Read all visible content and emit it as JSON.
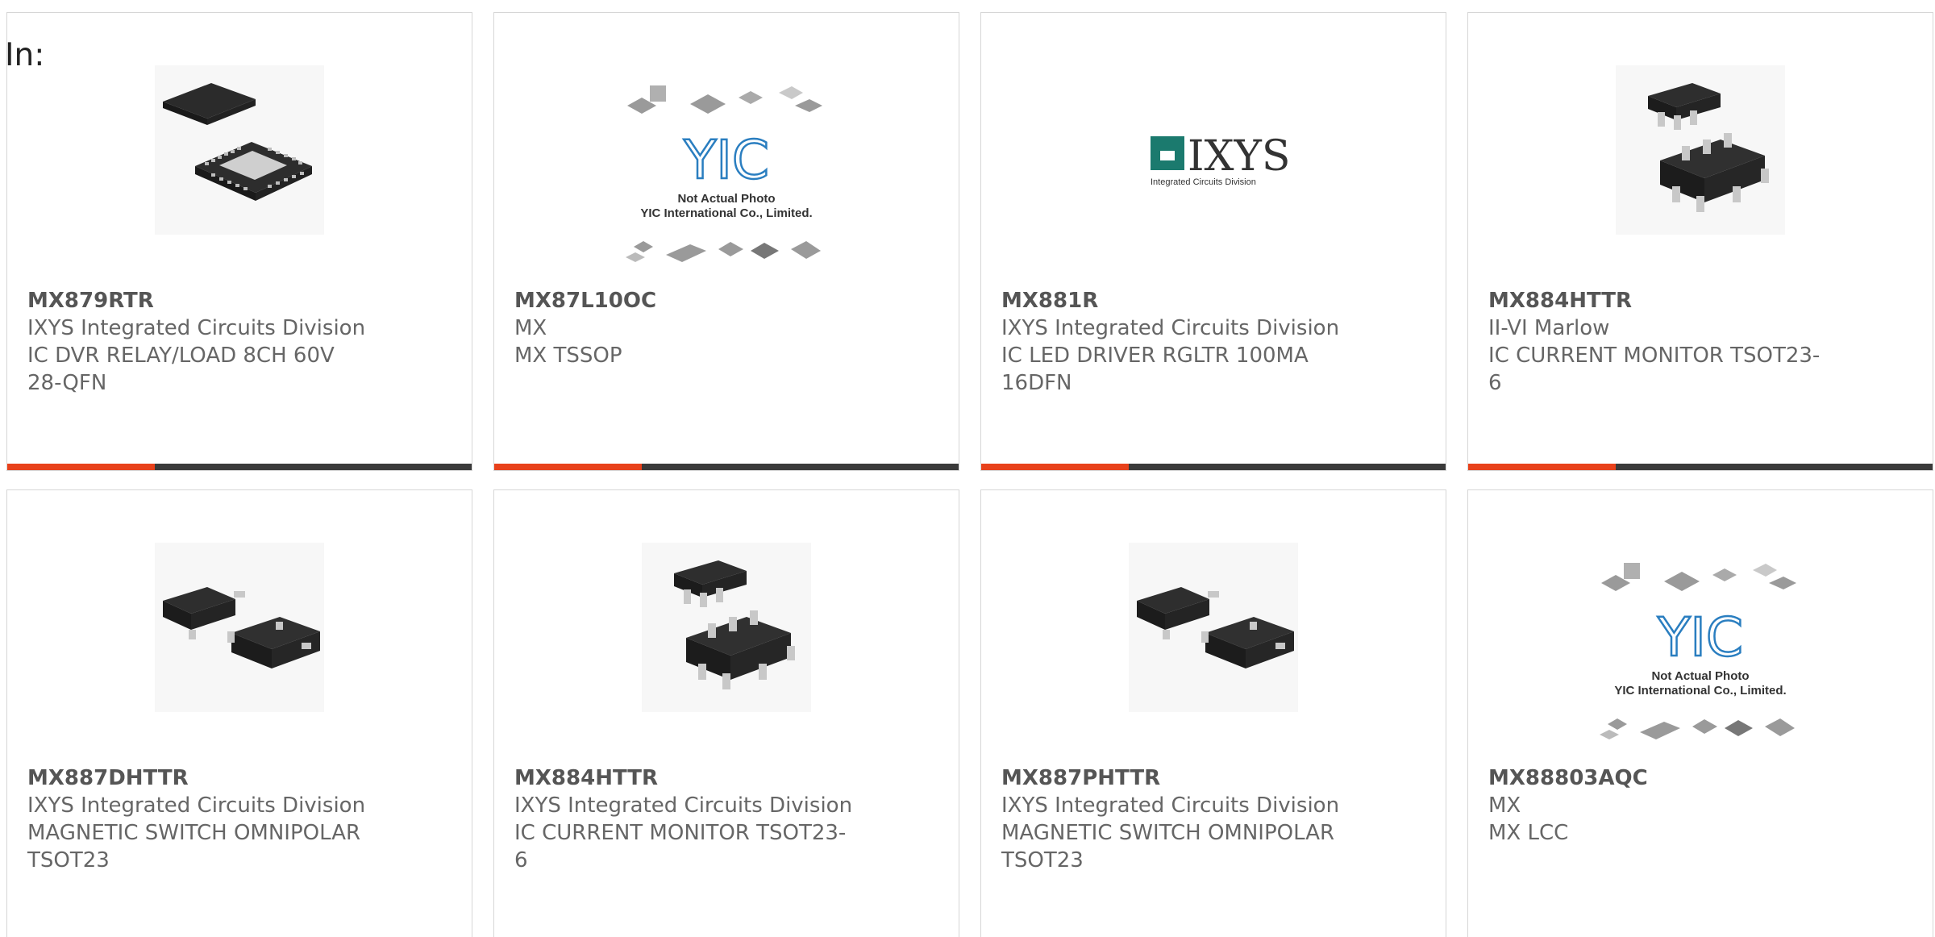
{
  "heading": "In:",
  "accent_color": "#e8411b",
  "bar_color": "#3a3a3a",
  "products": [
    {
      "part": "MX879RTR",
      "maker": "IXYS Integrated Circuits Division",
      "desc": "IC DVR RELAY/LOAD 8CH 60V 28-QFN",
      "image": "qfn-chip-icon"
    },
    {
      "part": "MX87L10OC",
      "maker": "MX",
      "desc": "MX TSSOP",
      "image": "yic-placeholder-icon"
    },
    {
      "part": "MX881R",
      "maker": "IXYS Integrated Circuits Division",
      "desc": "IC LED DRIVER RGLTR 100MA 16DFN",
      "image": "ixys-logo"
    },
    {
      "part": "MX884HTTR",
      "maker": "II-VI Marlow",
      "desc": "IC CURRENT MONITOR TSOT23-6",
      "image": "tsot23-6-chip-icon"
    },
    {
      "part": "MX887DHTTR",
      "maker": "IXYS Integrated Circuits Division",
      "desc": "MAGNETIC SWITCH OMNIPOLAR TSOT23",
      "image": "tsot23-chip-icon"
    },
    {
      "part": "MX884HTTR",
      "maker": "IXYS Integrated Circuits Division",
      "desc": "IC CURRENT MONITOR TSOT23-6",
      "image": "tsot23-6-chip-icon"
    },
    {
      "part": "MX887PHTTR",
      "maker": "IXYS Integrated Circuits Division",
      "desc": "MAGNETIC SWITCH OMNIPOLAR TSOT23",
      "image": "tsot23-chip-icon"
    },
    {
      "part": "MX88803AQC",
      "maker": "MX",
      "desc": "MX LCC",
      "image": "yic-placeholder-icon"
    }
  ],
  "placeholder": {
    "logo_text": "YIC",
    "line1": "Not Actual Photo",
    "line2": "YIC International Co., Limited."
  },
  "ixys_logo": {
    "wordmark": "IXYS",
    "subtitle": "Integrated Circuits Division",
    "brand_color": "#1b7a6e"
  }
}
